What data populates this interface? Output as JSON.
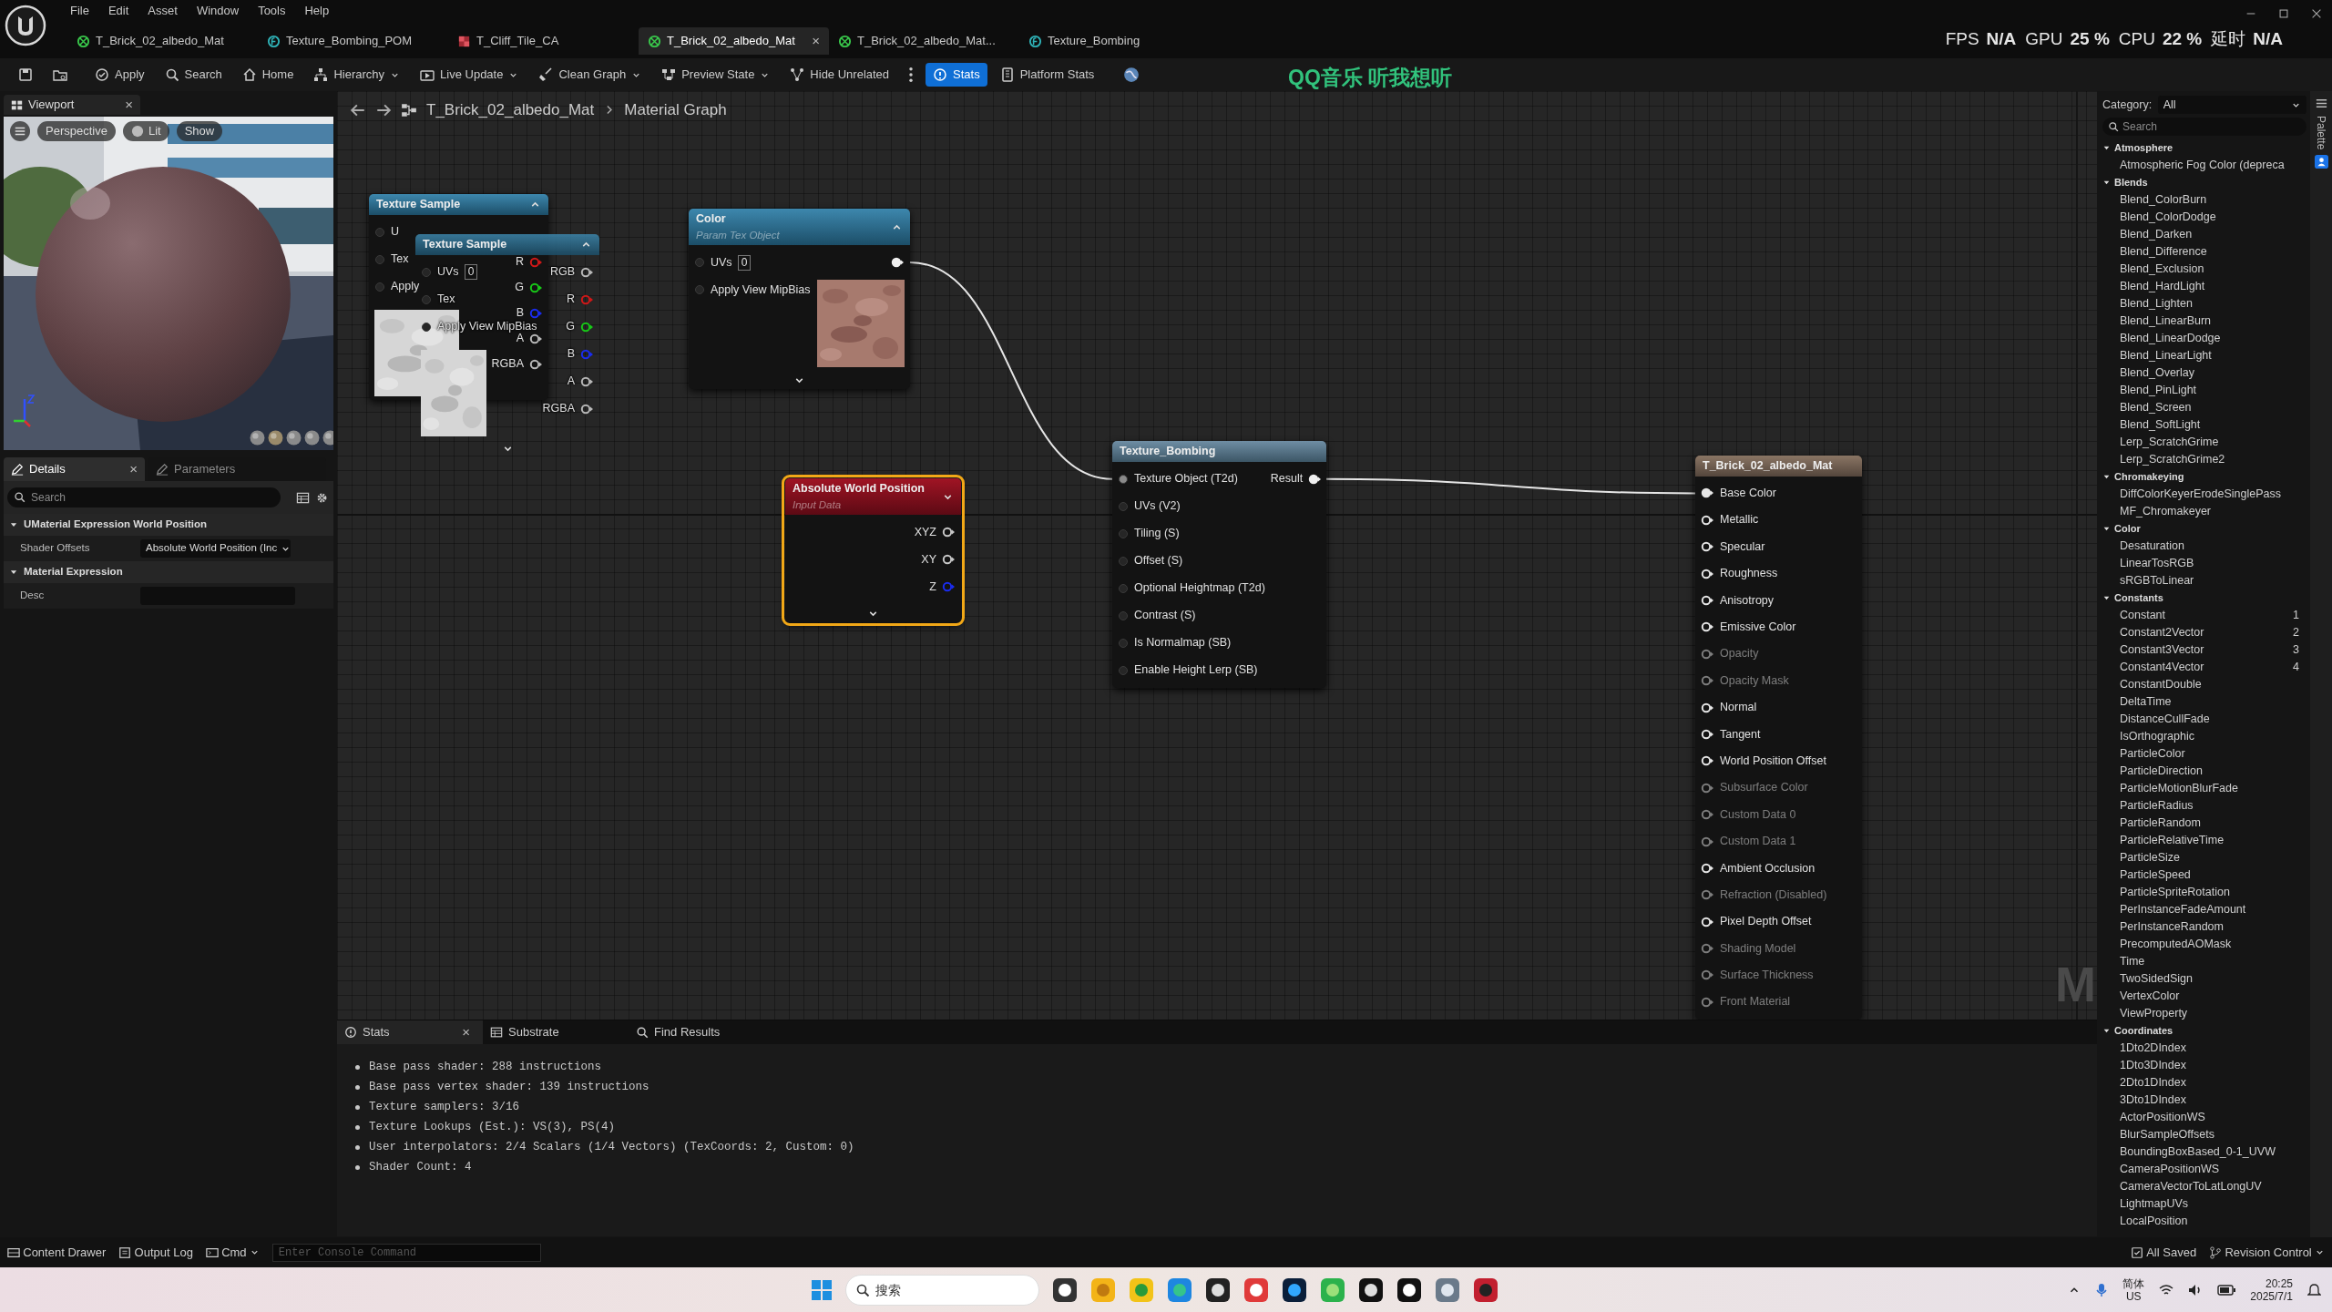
{
  "menu": [
    "File",
    "Edit",
    "Asset",
    "Window",
    "Tools",
    "Help"
  ],
  "tabs": [
    {
      "label": "T_Brick_02_albedo_Mat",
      "kind": "material",
      "selected": false
    },
    {
      "label": "Texture_Bombing_POM",
      "kind": "function",
      "selected": false
    },
    {
      "label": "T_Cliff_Tile_CA",
      "kind": "texture",
      "selected": false
    },
    {
      "label": "T_Brick_02_albedo_Mat",
      "kind": "material",
      "selected": true,
      "close": "×"
    },
    {
      "label": "T_Brick_02_albedo_Mat...",
      "kind": "material",
      "selected": false
    },
    {
      "label": "Texture_Bombing",
      "kind": "function",
      "selected": false
    }
  ],
  "perf": [
    {
      "text": "FPS",
      "kind": "label"
    },
    {
      "text": "N/A",
      "kind": "value"
    },
    {
      "text": "GPU",
      "kind": "label"
    },
    {
      "text": "25 %",
      "kind": "value"
    },
    {
      "text": "CPU",
      "kind": "label"
    },
    {
      "text": "22 %",
      "kind": "value"
    },
    {
      "text": "延时",
      "kind": "label"
    },
    {
      "text": "N/A",
      "kind": "value"
    }
  ],
  "toolbar": {
    "buttons": [
      {
        "label": "Apply",
        "dropdown": false,
        "selected": false
      },
      {
        "label": "Search",
        "dropdown": false,
        "selected": false
      },
      {
        "label": "Home",
        "dropdown": false,
        "selected": false
      },
      {
        "label": "Hierarchy",
        "dropdown": true,
        "selected": false
      },
      {
        "label": "Live Update",
        "dropdown": true,
        "selected": false
      },
      {
        "label": "Clean Graph",
        "dropdown": true,
        "selected": false
      },
      {
        "label": "Preview State",
        "dropdown": true,
        "selected": false
      },
      {
        "label": "Hide Unrelated",
        "dropdown": false,
        "selected": false
      },
      {
        "label": "Stats",
        "dropdown": false,
        "selected": true
      },
      {
        "label": "Platform Stats",
        "dropdown": false,
        "selected": false
      }
    ],
    "overlay_text": "QQ音乐 听我想听"
  },
  "viewport": {
    "tab": "Viewport",
    "close": "×",
    "buttons": [
      "Perspective",
      "Lit",
      "Show"
    ],
    "preview": {
      "kind": "picture"
    }
  },
  "details": {
    "tabs": [
      {
        "label": "Details",
        "selected": true,
        "close": "×"
      },
      {
        "label": "Parameters",
        "selected": false
      }
    ],
    "search_placeholder": "Search",
    "sections": [
      {
        "title": "UMaterial Expression World Position",
        "expanded": true,
        "rows": [
          {
            "label": "Shader Offsets",
            "kind": "dropdown",
            "value": "Absolute World Position (Inc"
          }
        ]
      },
      {
        "title": "Material Expression",
        "expanded": true,
        "rows": [
          {
            "label": "Desc",
            "kind": "text"
          }
        ]
      }
    ]
  },
  "graph": {
    "breadcrumb": [
      "T_Brick_02_albedo_Mat",
      "Material Graph"
    ],
    "watermark": "M",
    "nodes": [
      {
        "title": "Texture Sample",
        "kind": "texture",
        "selected": false,
        "collapsed": false,
        "advanced": false,
        "preview": {
          "kind": "picture"
        },
        "inputs": [
          {
            "label": "U",
            "connected": false
          },
          {
            "label": "Tex",
            "connected": false
          },
          {
            "label": "Apply",
            "connected": false
          }
        ],
        "outputs": [
          {
            "label": "R",
            "connected": false,
            "color": "#d01818"
          },
          {
            "label": "G",
            "connected": false,
            "color": "#18c818"
          },
          {
            "label": "B",
            "connected": false,
            "color": "#1a2cf0"
          },
          {
            "label": "A",
            "connected": false,
            "color": "#b8b8b8"
          },
          {
            "label": "RGBA",
            "connected": false,
            "color": "#b8b8b8"
          }
        ]
      },
      {
        "title": "Texture Sample",
        "kind": "texture",
        "selected": false,
        "collapsed": false,
        "advanced": true,
        "preview": {
          "kind": "picture"
        },
        "inputs": [
          {
            "label": "UVs",
            "connected": false,
            "value": "0"
          },
          {
            "label": "Tex",
            "connected": false
          },
          {
            "label": "Apply View MipBias",
            "connected": false
          }
        ],
        "outputs": [
          {
            "label": "RGB",
            "connected": false,
            "color": "#b8b8b8"
          },
          {
            "label": "R",
            "connected": false,
            "color": "#d01818"
          },
          {
            "label": "G",
            "connected": false,
            "color": "#18c818"
          },
          {
            "label": "B",
            "connected": false,
            "color": "#1a2cf0"
          },
          {
            "label": "A",
            "connected": false,
            "color": "#b8b8b8"
          },
          {
            "label": "RGBA",
            "connected": false,
            "color": "#b8b8b8"
          }
        ]
      },
      {
        "title": "Color",
        "subtitle": "Param Tex Object",
        "kind": "param",
        "selected": false,
        "collapsed": false,
        "advanced": true,
        "preview": {
          "kind": "picture"
        },
        "inputs": [
          {
            "label": "UVs",
            "connected": false,
            "value": "0"
          },
          {
            "label": "Apply View MipBias",
            "connected": false
          }
        ],
        "outputs": [
          {
            "connected": true,
            "color": "#f0f0f0"
          }
        ]
      },
      {
        "title": "Absolute World Position",
        "subtitle": "Input Data",
        "kind": "input",
        "selected": true,
        "collapsed": true,
        "advanced": true,
        "outputs": [
          {
            "label": "XYZ",
            "connected": false,
            "color": "#c8c8c8"
          },
          {
            "label": "XY",
            "connected": false,
            "color": "#c8c8c8"
          },
          {
            "label": "Z",
            "connected": false,
            "color": "#1a2cf0"
          }
        ]
      },
      {
        "title": "Texture_Bombing",
        "kind": "function",
        "selected": false,
        "advanced": false,
        "inputs": [
          {
            "label": "Texture Object (T2d)",
            "connected": true
          },
          {
            "label": "UVs (V2)",
            "connected": false
          },
          {
            "label": "Tiling (S)",
            "connected": false
          },
          {
            "label": "Offset (S)",
            "connected": false
          },
          {
            "label": "Optional Heightmap (T2d)",
            "connected": false
          },
          {
            "label": "Contrast (S)",
            "connected": false
          },
          {
            "label": "Is Normalmap (SB)",
            "connected": false
          },
          {
            "label": "Enable Height Lerp (SB)",
            "connected": false
          }
        ],
        "outputs": [
          {
            "label": "Result",
            "connected": true,
            "color": "#f0f0f0"
          }
        ]
      },
      {
        "title": "T_Brick_02_albedo_Mat",
        "kind": "result",
        "selected": false,
        "advanced": false,
        "inputs": [
          {
            "label": "Base Color",
            "connected": true,
            "disabled": false
          },
          {
            "label": "Metallic",
            "connected": false,
            "disabled": false
          },
          {
            "label": "Specular",
            "connected": false,
            "disabled": false
          },
          {
            "label": "Roughness",
            "connected": false,
            "disabled": false
          },
          {
            "label": "Anisotropy",
            "connected": false,
            "disabled": false
          },
          {
            "label": "Emissive Color",
            "connected": false,
            "disabled": false
          },
          {
            "label": "Opacity",
            "connected": false,
            "disabled": true
          },
          {
            "label": "Opacity Mask",
            "connected": false,
            "disabled": true
          },
          {
            "label": "Normal",
            "connected": false,
            "disabled": false
          },
          {
            "label": "Tangent",
            "connected": false,
            "disabled": false
          },
          {
            "label": "World Position Offset",
            "connected": false,
            "disabled": false
          },
          {
            "label": "Subsurface Color",
            "connected": false,
            "disabled": true
          },
          {
            "label": "Custom Data 0",
            "connected": false,
            "disabled": true
          },
          {
            "label": "Custom Data 1",
            "connected": false,
            "disabled": true
          },
          {
            "label": "Ambient Occlusion",
            "connected": false,
            "disabled": false
          },
          {
            "label": "Refraction (Disabled)",
            "connected": false,
            "disabled": true
          },
          {
            "label": "Pixel Depth Offset",
            "connected": false,
            "disabled": false
          },
          {
            "label": "Shading Model",
            "connected": false,
            "disabled": true
          },
          {
            "label": "Surface Thickness",
            "connected": false,
            "disabled": true
          },
          {
            "label": "Front Material",
            "connected": false,
            "disabled": true
          }
        ]
      }
    ]
  },
  "bottom_panel": {
    "tabs": [
      {
        "label": "Stats",
        "selected": true,
        "close": "×"
      },
      {
        "label": "Substrate",
        "selected": false
      },
      {
        "label": "Find Results",
        "selected": false
      }
    ],
    "lines": [
      "Base pass shader: 288 instructions",
      "Base pass vertex shader: 139 instructions",
      "Texture samplers: 3/16",
      "Texture Lookups (Est.): VS(3), PS(4)",
      "User interpolators: 2/4 Scalars (1/4 Vectors) (TexCoords: 2, Custom: 0)",
      "Shader Count: 4"
    ]
  },
  "palette": {
    "category_label": "Category:",
    "category": "All",
    "search_placeholder": "Search",
    "side_tab": "Palette",
    "groups": [
      {
        "label": "Atmosphere",
        "expanded": true,
        "children": [
          {
            "label": "Atmospheric Fog Color (depreca"
          }
        ]
      },
      {
        "label": "Blends",
        "expanded": true,
        "children": [
          {
            "label": "Blend_ColorBurn"
          },
          {
            "label": "Blend_ColorDodge"
          },
          {
            "label": "Blend_Darken"
          },
          {
            "label": "Blend_Difference"
          },
          {
            "label": "Blend_Exclusion"
          },
          {
            "label": "Blend_HardLight"
          },
          {
            "label": "Blend_Lighten"
          },
          {
            "label": "Blend_LinearBurn"
          },
          {
            "label": "Blend_LinearDodge"
          },
          {
            "label": "Blend_LinearLight"
          },
          {
            "label": "Blend_Overlay"
          },
          {
            "label": "Blend_PinLight"
          },
          {
            "label": "Blend_Screen"
          },
          {
            "label": "Blend_SoftLight"
          },
          {
            "label": "Lerp_ScratchGrime"
          },
          {
            "label": "Lerp_ScratchGrime2"
          }
        ]
      },
      {
        "label": "Chromakeying",
        "expanded": true,
        "children": [
          {
            "label": "DiffColorKeyerErodeSinglePass"
          },
          {
            "label": "MF_Chromakeyer"
          }
        ]
      },
      {
        "label": "Color",
        "expanded": true,
        "children": [
          {
            "label": "Desaturation"
          },
          {
            "label": "LinearTosRGB"
          },
          {
            "label": "sRGBToLinear"
          }
        ]
      },
      {
        "label": "Constants",
        "expanded": true,
        "children": [
          {
            "label": "Constant",
            "hotkey": "1"
          },
          {
            "label": "Constant2Vector",
            "hotkey": "2"
          },
          {
            "label": "Constant3Vector",
            "hotkey": "3"
          },
          {
            "label": "Constant4Vector",
            "hotkey": "4"
          },
          {
            "label": "ConstantDouble"
          },
          {
            "label": "DeltaTime"
          },
          {
            "label": "DistanceCullFade"
          },
          {
            "label": "IsOrthographic"
          },
          {
            "label": "ParticleColor"
          },
          {
            "label": "ParticleDirection"
          },
          {
            "label": "ParticleMotionBlurFade"
          },
          {
            "label": "ParticleRadius"
          },
          {
            "label": "ParticleRandom"
          },
          {
            "label": "ParticleRelativeTime"
          },
          {
            "label": "ParticleSize"
          },
          {
            "label": "ParticleSpeed"
          },
          {
            "label": "ParticleSpriteRotation"
          },
          {
            "label": "PerInstanceFadeAmount"
          },
          {
            "label": "PerInstanceRandom"
          },
          {
            "label": "PrecomputedAOMask"
          },
          {
            "label": "Time"
          },
          {
            "label": "TwoSidedSign"
          },
          {
            "label": "VertexColor"
          },
          {
            "label": "ViewProperty"
          }
        ]
      },
      {
        "label": "Coordinates",
        "expanded": true,
        "children": [
          {
            "label": "1Dto2DIndex"
          },
          {
            "label": "1Dto3DIndex"
          },
          {
            "label": "2Dto1DIndex"
          },
          {
            "label": "3Dto1DIndex"
          },
          {
            "label": "ActorPositionWS"
          },
          {
            "label": "BlurSampleOffsets"
          },
          {
            "label": "BoundingBoxBased_0-1_UVW"
          },
          {
            "label": "CameraPositionWS"
          },
          {
            "label": "CameraVectorToLatLongUV"
          },
          {
            "label": "LightmapUVs"
          },
          {
            "label": "LocalPosition"
          }
        ]
      }
    ]
  },
  "status_bar": {
    "left": [
      {
        "label": "Content Drawer",
        "dropdown": false
      },
      {
        "label": "Output Log",
        "dropdown": false
      },
      {
        "label": "Cmd",
        "dropdown": true
      }
    ],
    "console_placeholder": "Enter Console Command",
    "right": [
      {
        "label": "All Saved",
        "dropdown": false
      },
      {
        "label": "Revision Control",
        "dropdown": true
      }
    ]
  },
  "taskbar": {
    "search_placeholder": "搜索",
    "ime": [
      "简体",
      "US"
    ],
    "time": "20:25",
    "date": "2025/7/1"
  }
}
